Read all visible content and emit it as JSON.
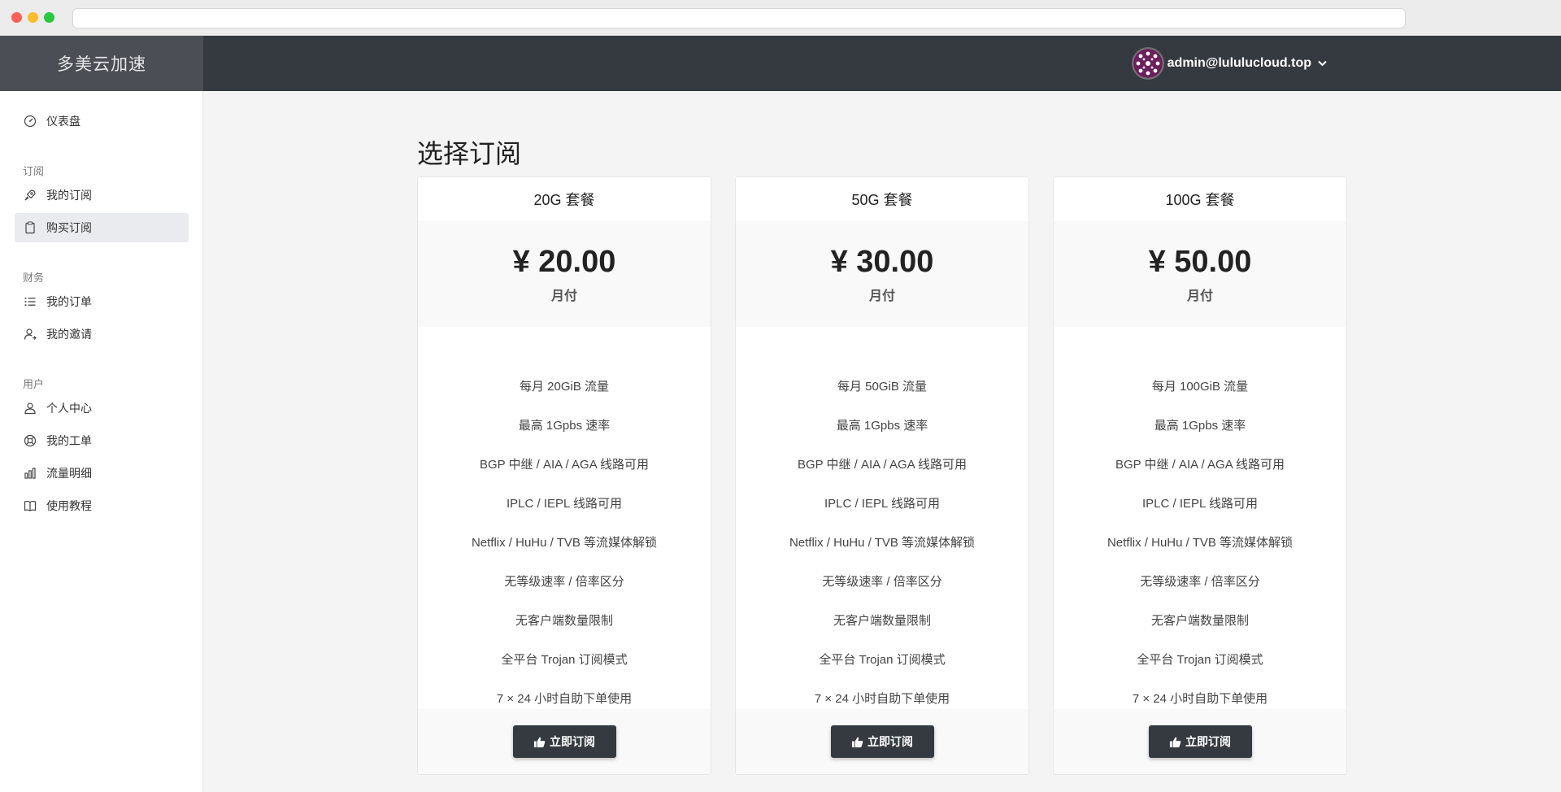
{
  "header": {
    "brand": "多美云加速",
    "user_email": "admin@lululucloud.top",
    "user_caret_icon": "chevron-down-icon"
  },
  "sidebar": {
    "items": [
      {
        "label": "仪表盘",
        "icon": "dashboard-gauge-icon"
      },
      {
        "section": "订阅"
      },
      {
        "label": "我的订阅",
        "icon": "rocket-icon"
      },
      {
        "label": "购买订阅",
        "icon": "clipboard-icon",
        "active": true
      },
      {
        "section": "财务"
      },
      {
        "label": "我的订单",
        "icon": "list-icon"
      },
      {
        "label": "我的邀请",
        "icon": "invite-user-icon"
      },
      {
        "section": "用户"
      },
      {
        "label": "个人中心",
        "icon": "user-icon"
      },
      {
        "label": "我的工单",
        "icon": "support-lifebuoy-icon"
      },
      {
        "label": "流量明细",
        "icon": "bar-chart-icon"
      },
      {
        "label": "使用教程",
        "icon": "book-icon"
      }
    ]
  },
  "main": {
    "title": "选择订阅",
    "plans": [
      {
        "name": "20G 套餐",
        "price": "¥ 20.00",
        "period": "月付",
        "features": [
          "每月 20GiB 流量",
          "最高 1Gpbs 速率",
          "BGP 中继 / AIA / AGA 线路可用",
          "IPLC / IEPL 线路可用",
          "Netflix / HuHu / TVB 等流媒体解锁",
          "无等级速率 / 倍率区分",
          "无客户端数量限制",
          "全平台 Trojan 订阅模式",
          "7 × 24 小时自助下单使用"
        ],
        "button": "立即订阅"
      },
      {
        "name": "50G 套餐",
        "price": "¥ 30.00",
        "period": "月付",
        "features": [
          "每月 50GiB 流量",
          "最高 1Gpbs 速率",
          "BGP 中继 / AIA / AGA 线路可用",
          "IPLC / IEPL 线路可用",
          "Netflix / HuHu / TVB 等流媒体解锁",
          "无等级速率 / 倍率区分",
          "无客户端数量限制",
          "全平台 Trojan 订阅模式",
          "7 × 24 小时自助下单使用"
        ],
        "button": "立即订阅"
      },
      {
        "name": "100G 套餐",
        "price": "¥ 50.00",
        "period": "月付",
        "features": [
          "每月 100GiB 流量",
          "最高 1Gpbs 速率",
          "BGP 中继 / AIA / AGA 线路可用",
          "IPLC / IEPL 线路可用",
          "Netflix / HuHu / TVB 等流媒体解锁",
          "无等级速率 / 倍率区分",
          "无客户端数量限制",
          "全平台 Trojan 订阅模式",
          "7 × 24 小时自助下单使用"
        ],
        "button": "立即订阅"
      }
    ]
  },
  "colors": {
    "topbar": "#343a40",
    "brand_bg": "#4b4e55",
    "page_bg": "#f4f4f4",
    "button_bg": "#343a40",
    "active_nav_bg": "#e9ebee"
  }
}
